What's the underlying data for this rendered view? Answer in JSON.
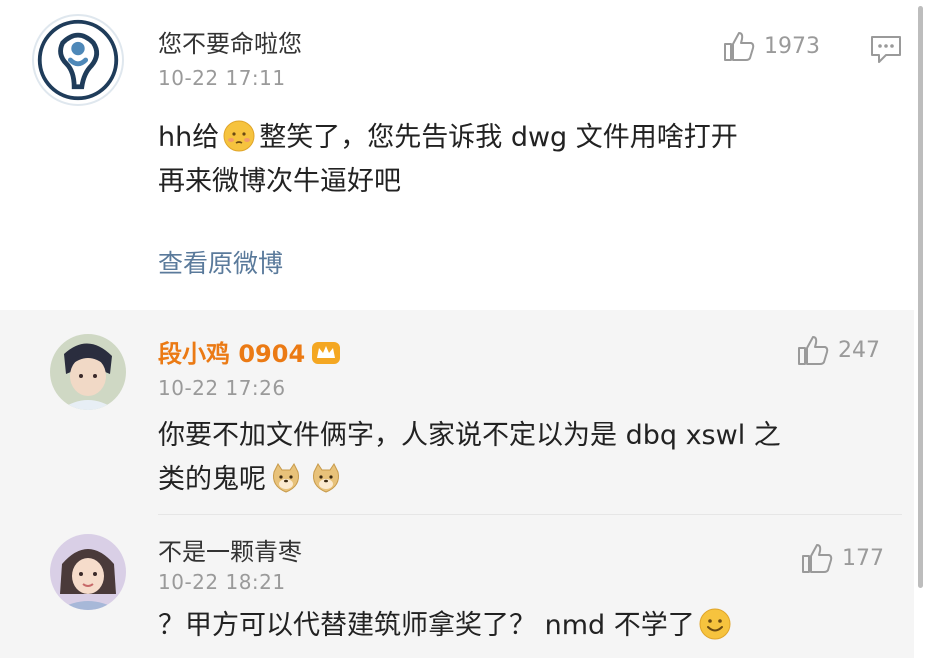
{
  "post": {
    "username": "您不要命啦您",
    "time": "10-22 17:11",
    "likes": "1973",
    "text_line1_a": "hh给",
    "text_line1_b": "整笑了，您先告诉我 dwg 文件用啥打开",
    "text_line2": "再来微博次牛逼好吧",
    "view_original": "查看原微博"
  },
  "replies": [
    {
      "username": "段小鸡 0904",
      "time": "10-22 17:26",
      "likes": "247",
      "text_line1": "你要不加文件俩字，人家说不定以为是 dbq xswl 之",
      "text_line2": "类的鬼呢"
    },
    {
      "username": "不是一颗青枣",
      "time": "10-22 18:21",
      "likes": "177",
      "text_line1": "？甲方可以代替建筑师拿奖了？ nmd 不学了"
    }
  ],
  "icons": {
    "like": "thumbs-up-icon",
    "comment": "comment-icon",
    "emoji_embarrassed": "embarrassed-emoji-icon",
    "emoji_doge": "doge-emoji-icon",
    "emoji_smile": "smile-emoji-icon",
    "vip": "vip-crown-icon"
  },
  "colors": {
    "vip_name": "#eb7a14",
    "link": "#5a7a9b",
    "meta": "#9a9a9a",
    "reply_bg": "#f5f5f5"
  }
}
